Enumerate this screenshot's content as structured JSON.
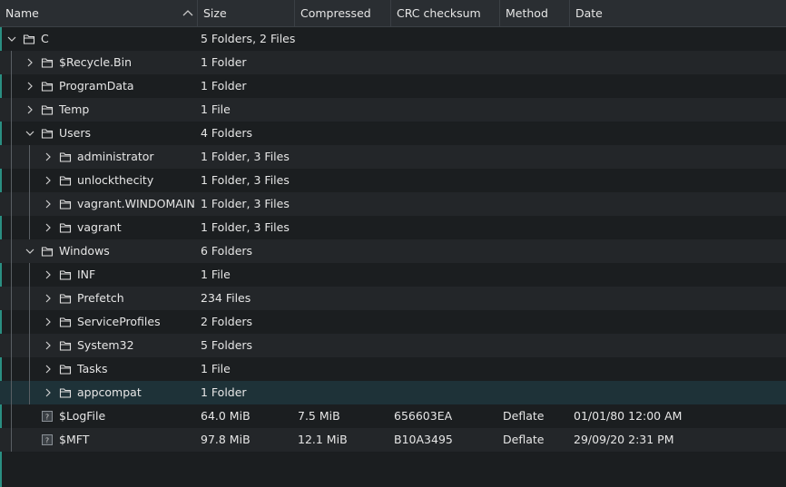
{
  "header": {
    "columns": [
      "Name",
      "Size",
      "Compressed",
      "CRC checksum",
      "Method",
      "Date"
    ]
  },
  "rows": [
    {
      "name": "C",
      "size": "5 Folders, 2 Files",
      "compressed": "",
      "crc": "",
      "method": "",
      "date": "",
      "level": 0,
      "type": "folder",
      "expanded": true
    },
    {
      "name": "$Recycle.Bin",
      "size": "1 Folder",
      "compressed": "",
      "crc": "",
      "method": "",
      "date": "",
      "level": 1,
      "type": "folder",
      "expanded": false
    },
    {
      "name": "ProgramData",
      "size": "1 Folder",
      "compressed": "",
      "crc": "",
      "method": "",
      "date": "",
      "level": 1,
      "type": "folder",
      "expanded": false
    },
    {
      "name": "Temp",
      "size": "1 File",
      "compressed": "",
      "crc": "",
      "method": "",
      "date": "",
      "level": 1,
      "type": "folder",
      "expanded": false
    },
    {
      "name": "Users",
      "size": "4 Folders",
      "compressed": "",
      "crc": "",
      "method": "",
      "date": "",
      "level": 1,
      "type": "folder",
      "expanded": true
    },
    {
      "name": "administrator",
      "size": "1 Folder, 3 Files",
      "compressed": "",
      "crc": "",
      "method": "",
      "date": "",
      "level": 2,
      "type": "folder",
      "expanded": false
    },
    {
      "name": "unlockthecity",
      "size": "1 Folder, 3 Files",
      "compressed": "",
      "crc": "",
      "method": "",
      "date": "",
      "level": 2,
      "type": "folder",
      "expanded": false
    },
    {
      "name": "vagrant.WINDOMAIN",
      "size": "1 Folder, 3 Files",
      "compressed": "",
      "crc": "",
      "method": "",
      "date": "",
      "level": 2,
      "type": "folder",
      "expanded": false
    },
    {
      "name": "vagrant",
      "size": "1 Folder, 3 Files",
      "compressed": "",
      "crc": "",
      "method": "",
      "date": "",
      "level": 2,
      "type": "folder",
      "expanded": false
    },
    {
      "name": "Windows",
      "size": "6 Folders",
      "compressed": "",
      "crc": "",
      "method": "",
      "date": "",
      "level": 1,
      "type": "folder",
      "expanded": true
    },
    {
      "name": "INF",
      "size": "1 File",
      "compressed": "",
      "crc": "",
      "method": "",
      "date": "",
      "level": 2,
      "type": "folder",
      "expanded": false
    },
    {
      "name": "Prefetch",
      "size": "234 Files",
      "compressed": "",
      "crc": "",
      "method": "",
      "date": "",
      "level": 2,
      "type": "folder",
      "expanded": false
    },
    {
      "name": "ServiceProfiles",
      "size": "2 Folders",
      "compressed": "",
      "crc": "",
      "method": "",
      "date": "",
      "level": 2,
      "type": "folder",
      "expanded": false
    },
    {
      "name": "System32",
      "size": "5 Folders",
      "compressed": "",
      "crc": "",
      "method": "",
      "date": "",
      "level": 2,
      "type": "folder",
      "expanded": false
    },
    {
      "name": "Tasks",
      "size": "1 File",
      "compressed": "",
      "crc": "",
      "method": "",
      "date": "",
      "level": 2,
      "type": "folder",
      "expanded": false
    },
    {
      "name": "appcompat",
      "size": "1 Folder",
      "compressed": "",
      "crc": "",
      "method": "",
      "date": "",
      "level": 2,
      "type": "folder",
      "expanded": false,
      "selected": true
    },
    {
      "name": "$LogFile",
      "size": "64.0 MiB",
      "compressed": "7.5 MiB",
      "crc": "656603EA",
      "method": "Deflate",
      "date": "01/01/80 12:00 AM",
      "level": 1,
      "type": "file"
    },
    {
      "name": "$MFT",
      "size": "97.8 MiB",
      "compressed": "12.1 MiB",
      "crc": "B10A3495",
      "method": "Deflate",
      "date": "29/09/20 2:31 PM",
      "level": 1,
      "type": "file"
    }
  ],
  "colors": {
    "background": "#1b1e20",
    "alt_row": "#232629",
    "selected_row": "#1e3238",
    "header": "#2a2e32",
    "accent": "#2a8f82"
  },
  "icons": {
    "sort": "chevron-up-icon",
    "folder": "folder-icon",
    "file": "unknown-file-icon",
    "expanded": "chevron-down-icon",
    "collapsed": "chevron-right-icon"
  }
}
